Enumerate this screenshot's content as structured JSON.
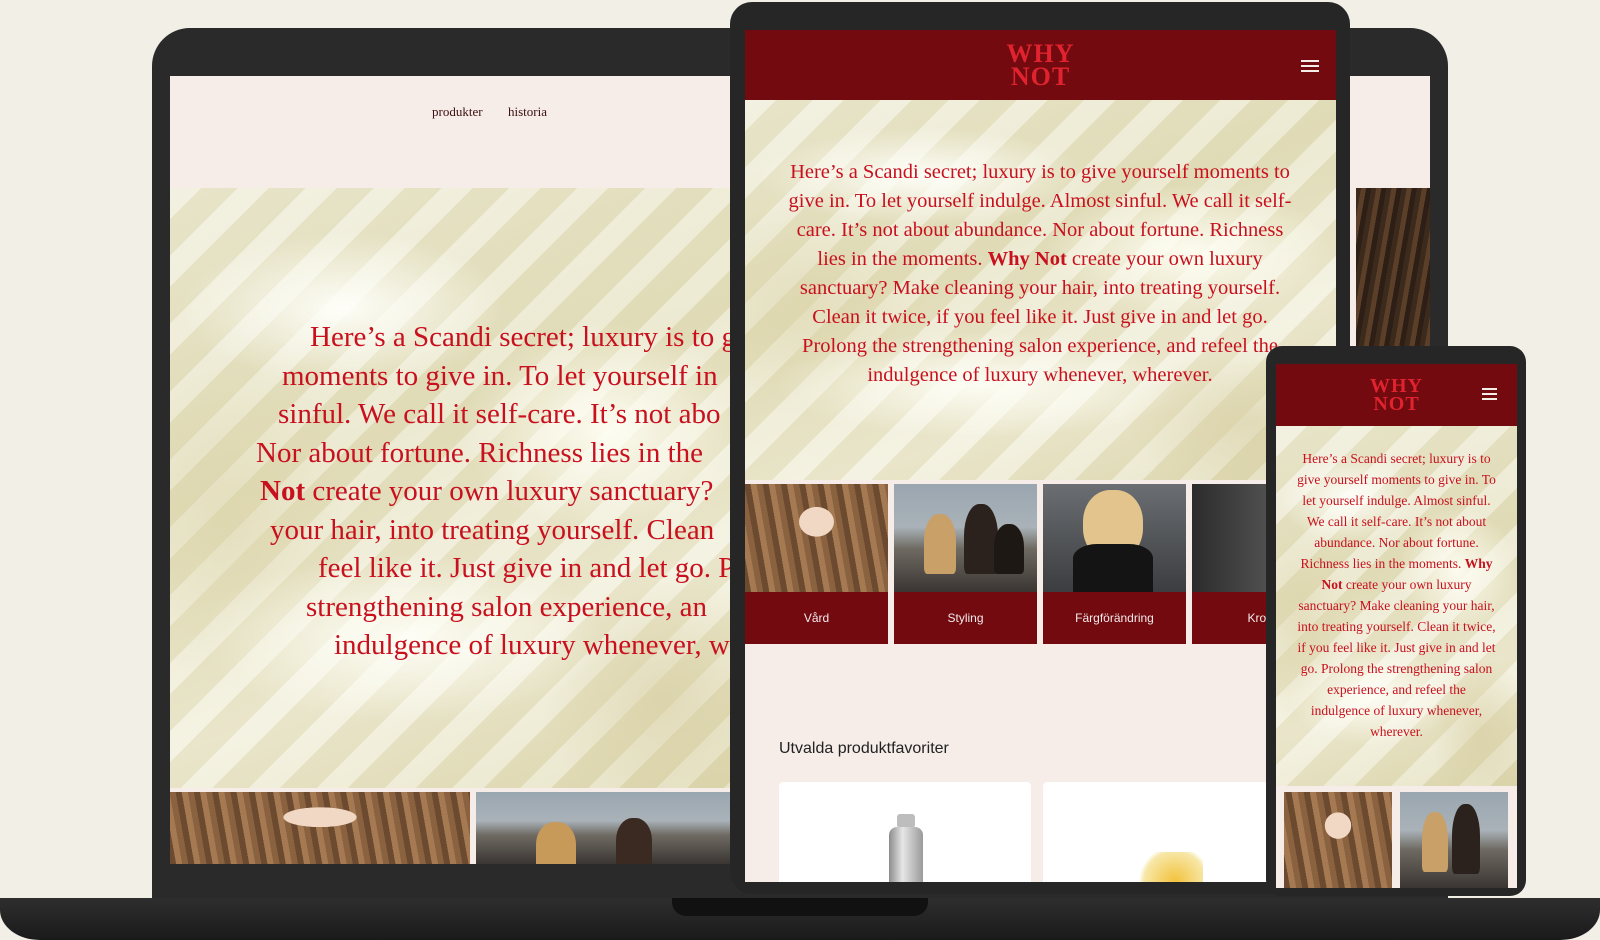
{
  "brand": {
    "logo_line1": "WHY",
    "logo_line2": "NOT"
  },
  "laptop": {
    "nav": {
      "item1": "produkter",
      "item2": "historia"
    },
    "hero": {
      "line1": "Here’s a Scandi secret; luxury is to g",
      "line2": "moments to give in. To let yourself in",
      "line3": "sinful. We call it self-care. It’s not abo",
      "line4": "Nor about fortune. Richness lies in the",
      "line5_bold": "Not",
      "line5_rest": " create your own luxury sanctuary?",
      "line6": "your hair, into treating yourself. Clean",
      "line7": "feel like it. Just give in and let go. P",
      "line8": "strengthening salon experience, an",
      "line9": "indulgence of luxury whenever, w"
    }
  },
  "tablet": {
    "hero": {
      "part1": "Here’s a Scandi secret; luxury is to give yourself moments to give in. To let yourself indulge. Almost sinful. We call it self-care. It’s not about abundance. Nor about fortune. Richness lies in the moments. ",
      "bold": "Why Not",
      "part2": " create your own luxury sanctuary? Make cleaning your hair, into treating yourself. Clean it twice, if you feel like it. Just give in and let go. Prolong the strengthening salon experience, and refeel the indulgence of luxury whenever, wherever."
    },
    "categories": [
      "Vård",
      "Styling",
      "Färgförändring",
      "Kropp"
    ],
    "section_title": "Utvalda produktfavoriter"
  },
  "phone": {
    "hero": {
      "part1": "Here’s a Scandi secret; luxury is to give yourself moments to give in. To let yourself indulge. Almost sinful. We call it self-care. It’s not about abundance. Nor about fortune. Richness lies in the moments. ",
      "bold": "Why Not",
      "part2": " create your own luxury sanctuary? Make cleaning your hair, into treating yourself. Clean it twice, if you feel like it. Just give in and let go. Prolong the strengthening salon experience, and refeel the indulgence of luxury whenever, wherever."
    }
  },
  "colors": {
    "brand_dark_red": "#720a10",
    "brand_red": "#c8101e",
    "page_bg": "#f6ece8"
  }
}
